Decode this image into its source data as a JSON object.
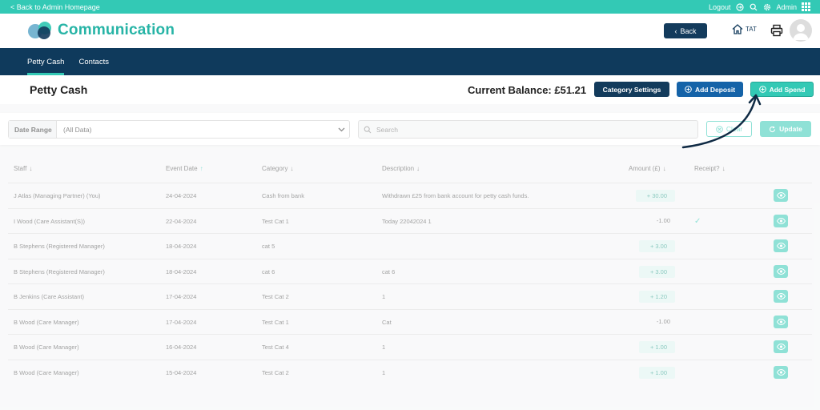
{
  "topbar": {
    "back_link": "< Back to Admin Homepage",
    "logout": "Logout",
    "admin": "Admin",
    "icons": [
      "logout-icon",
      "search-icon",
      "gear-icon",
      "grid-icon"
    ]
  },
  "header": {
    "title": "Communication",
    "back_button": "Back",
    "home_label": "TAT"
  },
  "nav": {
    "tabs": [
      {
        "label": "Petty Cash",
        "active": true
      },
      {
        "label": "Contacts",
        "active": false
      }
    ]
  },
  "page": {
    "title": "Petty Cash",
    "balance": "Current Balance: £51.21",
    "category_settings": "Category Settings",
    "add_deposit": "Add Deposit",
    "add_spend": "Add Spend"
  },
  "filters": {
    "date_range_label": "Date Range",
    "date_range_value": "(All Data)",
    "search_placeholder": "Search",
    "clear": "Clear",
    "update": "Update"
  },
  "table": {
    "headers": [
      "Staff",
      "Event Date",
      "Category",
      "Description",
      "Amount (£)",
      "Receipt?"
    ],
    "rows": [
      {
        "staff": "J Atlas (Managing Partner) (You)",
        "date": "24-04-2024",
        "category": "Cash from bank",
        "description": "Withdrawn £25 from bank account for petty cash funds.",
        "amount": "+ 30.00",
        "positive": true,
        "receipt": ""
      },
      {
        "staff": "I Wood (Care Assistant(S))",
        "date": "22-04-2024",
        "category": "Test Cat 1",
        "description": "Today 22042024 1",
        "amount": "-1.00",
        "positive": false,
        "receipt": "✓"
      },
      {
        "staff": "B Stephens (Registered Manager)",
        "date": "18-04-2024",
        "category": "cat 5",
        "description": "",
        "amount": "+ 3.00",
        "positive": true,
        "receipt": ""
      },
      {
        "staff": "B Stephens (Registered Manager)",
        "date": "18-04-2024",
        "category": "cat 6",
        "description": "cat 6",
        "amount": "+ 3.00",
        "positive": true,
        "receipt": ""
      },
      {
        "staff": "B Jenkins (Care Assistant)",
        "date": "17-04-2024",
        "category": "Test Cat 2",
        "description": "1",
        "amount": "+ 1.20",
        "positive": true,
        "receipt": ""
      },
      {
        "staff": "B Wood (Care Manager)",
        "date": "17-04-2024",
        "category": "Test Cat 1",
        "description": "Cat",
        "amount": "-1.00",
        "positive": false,
        "receipt": ""
      },
      {
        "staff": "B Wood (Care Manager)",
        "date": "16-04-2024",
        "category": "Test Cat 4",
        "description": "1",
        "amount": "+ 1.00",
        "positive": true,
        "receipt": ""
      },
      {
        "staff": "B Wood (Care Manager)",
        "date": "15-04-2024",
        "category": "Test Cat 2",
        "description": "1",
        "amount": "+ 1.00",
        "positive": true,
        "receipt": ""
      }
    ]
  },
  "colors": {
    "teal": "#33c9b5",
    "navy": "#0f3a5c",
    "blue": "#1563a8"
  }
}
